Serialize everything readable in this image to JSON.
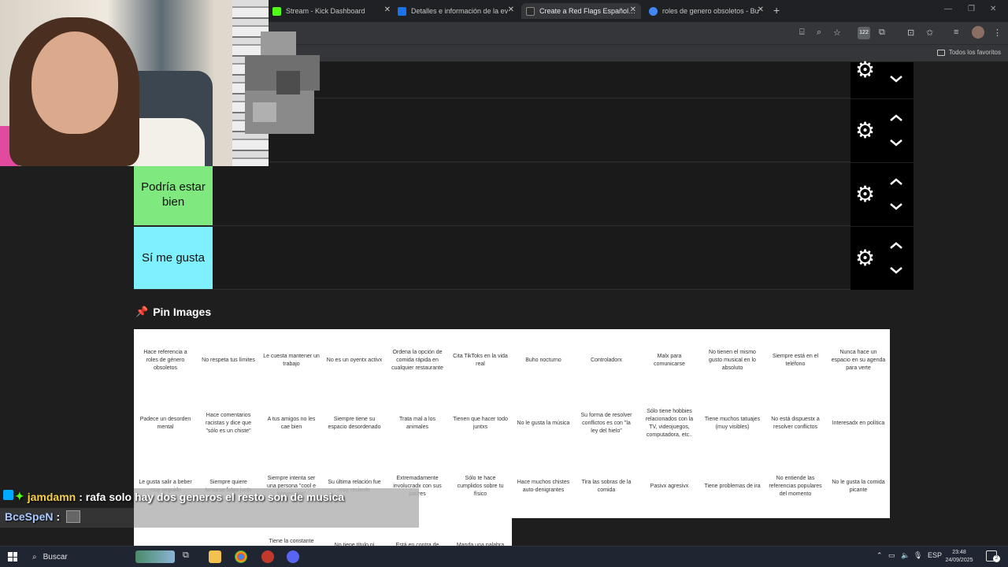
{
  "browser": {
    "tabs": [
      {
        "title": "Stream - Kick Dashboard",
        "favicon_color": "#53fc18",
        "active": false
      },
      {
        "title": "Detalles e información de la ev",
        "favicon_color": "#1a73e8",
        "active": false
      },
      {
        "title": "Create a Red Flags Español Tier",
        "favicon_color": "#2b2b2b",
        "active": true
      },
      {
        "title": "roles de genero obsoletos - Bu",
        "favicon_color": "#4285f4",
        "active": false
      }
    ],
    "new_tab": "+",
    "extensions_badge": "122",
    "bookmarks_all": "Todos los favoritos"
  },
  "tiers": [
    {
      "label": "",
      "color": "#1a1a1a"
    },
    {
      "label": "",
      "color": "#1a1a1a"
    },
    {
      "label": "Podría estar bien",
      "color": "#7fe87f"
    },
    {
      "label": "Sí me gusta",
      "color": "#7ff0ff"
    }
  ],
  "pin_images": {
    "title": "Pin Images",
    "cards_row1": [
      "Hace referencia a roles de género obsoletos",
      "No respeta tus límites",
      "Le cuesta mantener un trabajo",
      "No es un oyentx activx",
      "Ordena la opción de comida rápida en cualquier restaurante",
      "Cita TikToks en la vida real",
      "Buho nocturno",
      "Controladorx",
      "Malx para comunicarse",
      "No tienen el mismo gusto musical en lo absoluto",
      "Siempre está en el teléfono",
      "Nunca hace un espacio en su agenda para verte"
    ],
    "cards_row2": [
      "Padece un desorden mental",
      "Hace comentarios racistas y dice que \"sólo es un chiste\"",
      "A tus amigos no les cae bien",
      "Siempre tiene su espacio desordenado",
      "Trata mal a los animales",
      "Tienen que hacer todo juntxs",
      "No le gusta la música",
      "Su forma de resolver conflictos es con \"la ley del hielo\"",
      "Sólo tiene hobbies relacionados con la TV, videojuegos, computadora, etc..",
      "Tiene muchos tatuajes (muy visibles)",
      "No está dispuestx a resolver conflictos",
      "Interesadx en política"
    ],
    "cards_row3": [
      "Le gusta salir a beber muy seguido",
      "Siempre quiere tomarse fotos juntx",
      "Siempre intenta ser una persona \"cool e interesante\"",
      "Su última relación fue muy reciente",
      "Extremadamente involucradx con sus padres",
      "Sólo te hace cumplidos sobre tu físico",
      "Hace muchos chistes auto-denigrantes",
      "Tira las sobras de la comida",
      "Pasivx agresivx",
      "Tiene problemas de ira",
      "No entiende las referencias populares del momento",
      "No le gusta la comida picante"
    ],
    "cards_row4": [
      "",
      "",
      "Tiene la constante necesidad de",
      "No tiene título ni",
      "Está en contra de",
      "Manda una palabra"
    ]
  },
  "chat": [
    {
      "user": "jamdamn",
      "message": ": rafa solo hay dos generos el resto son de musica"
    },
    {
      "user": "BceSpeN",
      "message": ":"
    }
  ],
  "taskbar": {
    "search_label": "Buscar",
    "language": "ESP",
    "time": "23:48",
    "date": "24/09/2025",
    "notifications": "2"
  }
}
